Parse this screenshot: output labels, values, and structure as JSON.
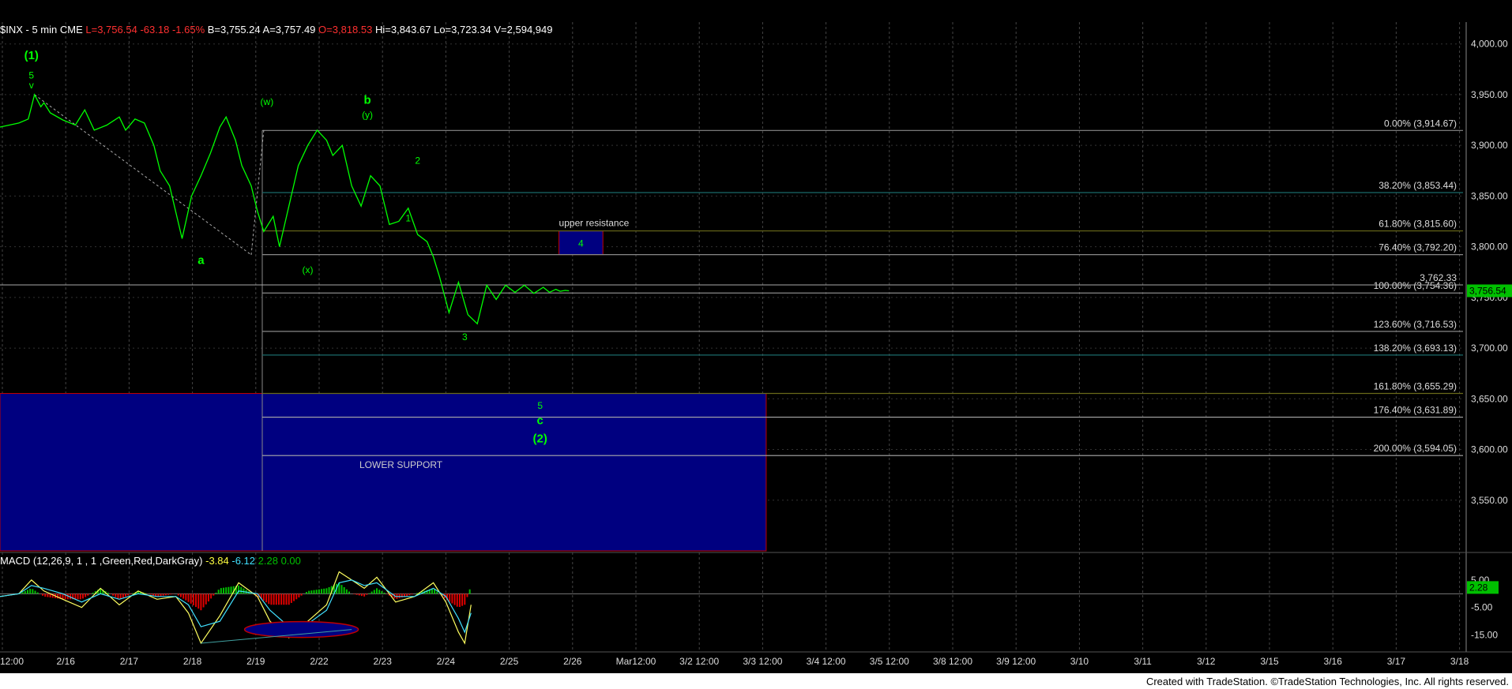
{
  "header": {
    "symbol": "$INX - 5 min  CME",
    "last": "L=3,756.54",
    "chg": "-63.18",
    "pct": "-1.65%",
    "bid": "B=3,755.24",
    "ask": "A=3,757.49",
    "open": "O=3,818.53",
    "hi": "Hi=3,843.67",
    "lo": "Lo=3,723.34",
    "vol": "V=2,594,949"
  },
  "macd_header": {
    "label": "MACD (12,26,9, 1 , 1 ,Green,Red,DarkGray)",
    "v1": "-3.84",
    "v2": "-6.12",
    "v3": "2.28",
    "v4": "0.00"
  },
  "footer": "Created with TradeStation. ©TradeStation Technologies, Inc. All rights reserved.",
  "colors": {
    "price": "#00ff00",
    "grid": "#555555",
    "zone": "#000080",
    "text": "#ffffff"
  },
  "chart_data": [
    {
      "type": "line",
      "title": "$INX - 5 min",
      "ylim": [
        3500,
        4020
      ],
      "y_ticks": [
        "4,000.00",
        "3,950.00",
        "3,900.00",
        "3,850.00",
        "3,800.00",
        "3,750.00",
        "3,700.00",
        "3,650.00",
        "3,600.00",
        "3,550.00"
      ],
      "y_tick_values": [
        4000,
        3950,
        3900,
        3850,
        3800,
        3750,
        3700,
        3650,
        3600,
        3550
      ],
      "x_labels": [
        "12:00",
        "2/16",
        "2/17",
        "2/18",
        "2/19",
        "2/22",
        "2/23",
        "2/24",
        "2/25",
        "2/26",
        "Mar12:00",
        "3/2 12:00",
        "3/3 12:00",
        "3/4 12:00",
        "3/5 12:00",
        "3/8 12:00",
        "3/9 12:00",
        "3/10",
        "3/11",
        "3/12",
        "3/15",
        "3/16",
        "3/17",
        "3/18"
      ],
      "series": [
        {
          "x": [
            0.0,
            0.3,
            0.45,
            0.55,
            0.65,
            0.7,
            0.8,
            1.0,
            1.2,
            1.35,
            1.5,
            1.7,
            1.9,
            2.0,
            2.15,
            2.3,
            2.45,
            2.55,
            2.7,
            2.9,
            3.05,
            3.2,
            3.35,
            3.5,
            3.6,
            3.75,
            3.85,
            4.0,
            4.1,
            4.2,
            4.35,
            4.45,
            4.6,
            4.75,
            4.9,
            5.05,
            5.2,
            5.3,
            5.45,
            5.6,
            5.75,
            5.9,
            6.05,
            6.2,
            6.35,
            6.5,
            6.65,
            6.8,
            6.9,
            7.0,
            7.15,
            7.3,
            7.45,
            7.6,
            7.75,
            7.9,
            8.05,
            8.2,
            8.35,
            8.5,
            8.65,
            8.75,
            8.85,
            8.92,
            9.0,
            9.06
          ],
          "values": [
            3918,
            3922,
            3926,
            3950,
            3938,
            3942,
            3932,
            3925,
            3920,
            3935,
            3915,
            3920,
            3928,
            3915,
            3926,
            3922,
            3900,
            3875,
            3860,
            3808,
            3850,
            3870,
            3892,
            3918,
            3928,
            3905,
            3880,
            3860,
            3835,
            3815,
            3830,
            3800,
            3840,
            3880,
            3900,
            3915,
            3905,
            3890,
            3900,
            3860,
            3840,
            3870,
            3860,
            3822,
            3825,
            3838,
            3812,
            3805,
            3790,
            3770,
            3735,
            3765,
            3733,
            3724,
            3762,
            3748,
            3762,
            3755,
            3762,
            3754,
            3760,
            3755,
            3758,
            3756,
            3757,
            3756.5
          ]
        }
      ],
      "fib_levels": [
        {
          "label": "0.00% (3,914.67)",
          "value": 3914.67,
          "color": "#888888"
        },
        {
          "label": "38.20% (3,853.44)",
          "value": 3853.44,
          "color": "#1a6a6a"
        },
        {
          "label": "61.80% (3,815.60)",
          "value": 3815.6,
          "color": "#6a6a1a"
        },
        {
          "label": "76.40% (3,792.20)",
          "value": 3792.2,
          "color": "#888888"
        },
        {
          "label": "100.00% (3,754.36)",
          "value": 3754.36,
          "color": "#888888"
        },
        {
          "label": "123.60% (3,716.53)",
          "value": 3716.53,
          "color": "#888888"
        },
        {
          "label": "138.20% (3,693.13)",
          "value": 3693.13,
          "color": "#1a6a6a"
        },
        {
          "label": "161.80% (3,655.29)",
          "value": 3655.29,
          "color": "#6a6a1a"
        },
        {
          "label": "176.40% (3,631.89)",
          "value": 3631.89,
          "color": "#aaaaaa"
        },
        {
          "label": "200.00% (3,594.05)",
          "value": 3594.05,
          "color": "#aaaaaa"
        }
      ],
      "price_line": {
        "label": "3,762.33",
        "value": 3762.33
      },
      "last_price": {
        "label": "3,756.54",
        "value": 3756.54
      },
      "zones": [
        {
          "label": "upper resistance",
          "inner": "4",
          "y_top": 3815.6,
          "y_bottom": 3792.2,
          "x_start": 8.9,
          "x_end": 9.6
        },
        {
          "label": "LOWER SUPPORT",
          "y_top": 3655.29,
          "y_bottom": 3500,
          "x_start": 0,
          "x_end": 12.2
        }
      ],
      "wave_labels": [
        {
          "text": "(1)",
          "x": 0.5,
          "y": 3985
        },
        {
          "text": "5",
          "x": 0.5,
          "y": 3966
        },
        {
          "text": "v",
          "x": 0.5,
          "y": 3956
        },
        {
          "text": "(w)",
          "x": 4.25,
          "y": 3940
        },
        {
          "text": "b",
          "x": 5.85,
          "y": 3941
        },
        {
          "text": "(y)",
          "x": 5.85,
          "y": 3927
        },
        {
          "text": "2",
          "x": 6.65,
          "y": 3882
        },
        {
          "text": "1",
          "x": 6.5,
          "y": 3825
        },
        {
          "text": "a",
          "x": 3.2,
          "y": 3783
        },
        {
          "text": "(x)",
          "x": 4.9,
          "y": 3774
        },
        {
          "text": "3",
          "x": 7.4,
          "y": 3708
        },
        {
          "text": "5",
          "x": 8.6,
          "y": 3640
        },
        {
          "text": "c",
          "x": 8.6,
          "y": 3625
        },
        {
          "text": "(2)",
          "x": 8.6,
          "y": 3607
        }
      ]
    },
    {
      "type": "line",
      "title": "MACD (12,26,9, 1 , 1 ,Green,Red,DarkGray)",
      "ylim": [
        -20,
        11
      ],
      "y_ticks": [
        "5.00",
        "-5.00",
        "-15.00"
      ],
      "y_tick_values": [
        5,
        -5,
        -15
      ],
      "last_value": "2.28",
      "series": [
        {
          "name": "MACD",
          "x": [
            0,
            0.3,
            0.5,
            0.7,
            1.0,
            1.3,
            1.6,
            1.9,
            2.2,
            2.5,
            2.8,
            3.0,
            3.2,
            3.5,
            3.8,
            4.1,
            4.3,
            4.6,
            4.9,
            5.2,
            5.4,
            5.6,
            5.8,
            6.0,
            6.3,
            6.6,
            6.9,
            7.1,
            7.3,
            7.4,
            7.5
          ],
          "values": [
            -1,
            0,
            5,
            1,
            -2,
            -5,
            2,
            -4,
            1,
            -2,
            -1,
            -7,
            -18,
            -8,
            4,
            -1,
            -10,
            -16,
            -10,
            -4,
            8,
            5,
            2,
            6,
            -3,
            -1,
            4,
            -3,
            -14,
            -18,
            -4
          ]
        },
        {
          "name": "Signal",
          "x": [
            0,
            0.3,
            0.5,
            0.7,
            1.0,
            1.3,
            1.6,
            1.9,
            2.2,
            2.5,
            2.8,
            3.0,
            3.2,
            3.5,
            3.8,
            4.1,
            4.3,
            4.6,
            4.9,
            5.2,
            5.4,
            5.6,
            5.8,
            6.0,
            6.3,
            6.6,
            6.9,
            7.1,
            7.3,
            7.4,
            7.5
          ],
          "values": [
            -1,
            0,
            3,
            2,
            0,
            -3,
            0,
            -2,
            0,
            -1,
            -1,
            -4,
            -12,
            -10,
            1,
            0,
            -6,
            -12,
            -11,
            -6,
            4,
            5,
            3,
            4,
            -1,
            -1,
            2,
            -1,
            -9,
            -14,
            -7
          ]
        }
      ]
    }
  ]
}
